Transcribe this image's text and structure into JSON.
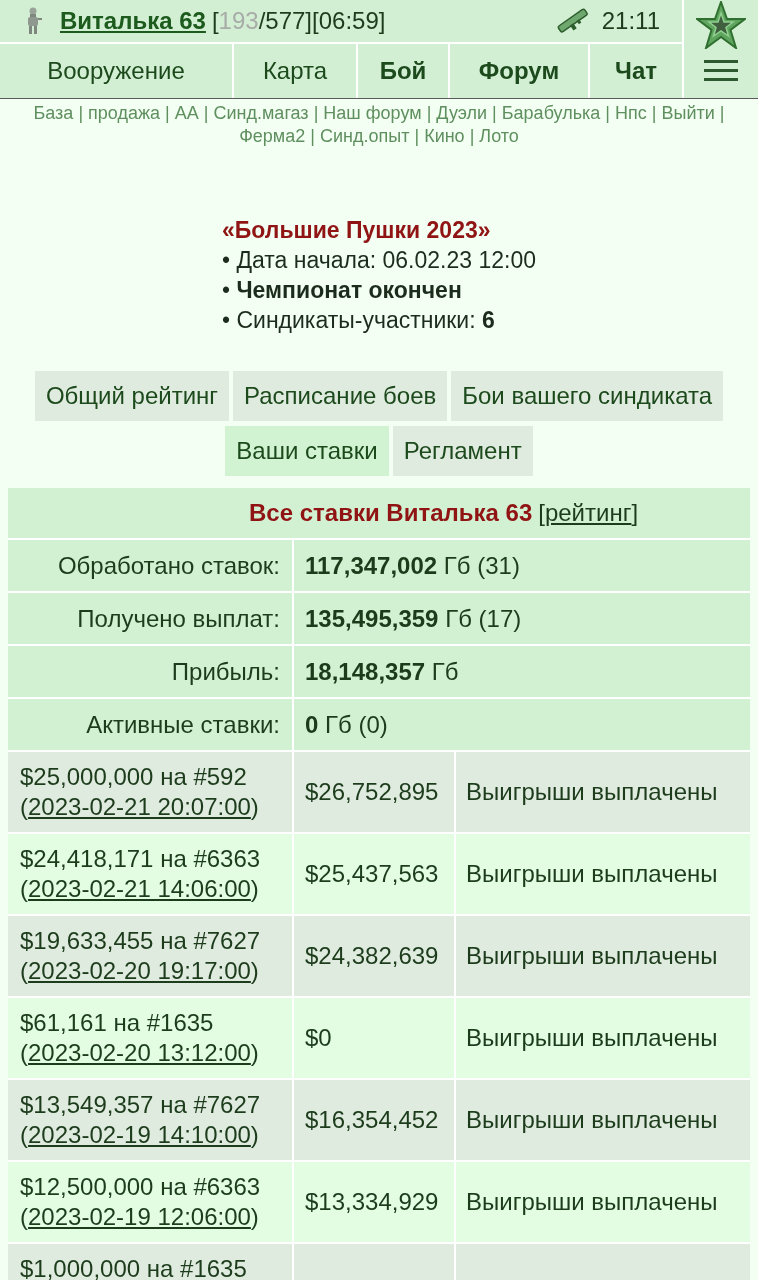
{
  "header": {
    "player": {
      "name": "Виталька 63",
      "stats": [
        {
          "text": "[",
          "dim": false
        },
        {
          "text": "193",
          "dim": true
        },
        {
          "text": "/577][06:59]",
          "dim": false
        }
      ]
    },
    "clock": "21:11",
    "nav": [
      {
        "label": "Вооружение",
        "bold": false
      },
      {
        "label": "Карта",
        "bold": false
      },
      {
        "label": "Бой",
        "bold": true
      },
      {
        "label": "Форум",
        "bold": true
      },
      {
        "label": "Чат",
        "bold": true
      }
    ]
  },
  "links": {
    "separator": "|",
    "items": [
      "База",
      "продажа",
      "АА",
      "Синд.магаз",
      "Наш форум",
      "Дуэли",
      "Барабулька",
      "Нпс",
      "Выйти",
      "Ферма2",
      "Синд.опыт",
      "Кино",
      "Лото"
    ]
  },
  "event": {
    "title": "«Большие Пушки 2023»",
    "facts": [
      "• Дата начала: 06.02.23 12:00",
      "• **Чемпионат окончен**",
      "• Синдикаты-участники: **6**"
    ]
  },
  "tabs": [
    {
      "label": "Общий рейтинг",
      "selected": false
    },
    {
      "label": "Расписание боев",
      "selected": false
    },
    {
      "label": "Бои вашего синдиката",
      "selected": false
    },
    {
      "label": "Ваши ставки",
      "selected": true
    },
    {
      "label": "Регламент",
      "selected": false
    }
  ],
  "bets_table": {
    "title": "Все ставки Виталька 63",
    "rating_link": {
      "open": "[",
      "label": "рейтинг",
      "close": "]"
    },
    "summary": [
      {
        "label": "Обработано ставок:",
        "value": "**117,347,002** Гб (31)"
      },
      {
        "label": "Получено выплат:",
        "value": "**135,495,359** Гб (17)"
      },
      {
        "label": "Прибыль:",
        "value": "**18,148,357** Гб"
      },
      {
        "label": "Активные ставки:",
        "value": "**0** Гб (0)"
      }
    ],
    "date_brackets": [
      "(",
      ")"
    ],
    "rows": [
      {
        "bet": "$25,000,000 на #592",
        "date": "2023-02-21 20:07:00",
        "payout": "$26,752,895",
        "status": "Выигрыши выплачены"
      },
      {
        "bet": "$24,418,171 на #6363",
        "date": "2023-02-21 14:06:00",
        "payout": "$25,437,563",
        "status": "Выигрыши выплачены"
      },
      {
        "bet": "$19,633,455 на #7627",
        "date": "2023-02-20 19:17:00",
        "payout": "$24,382,639",
        "status": "Выигрыши выплачены"
      },
      {
        "bet": "$61,161 на #1635",
        "date": "2023-02-20 13:12:00",
        "payout": "$0",
        "status": "Выигрыши выплачены"
      },
      {
        "bet": "$13,549,357 на #7627",
        "date": "2023-02-19 14:10:00",
        "payout": "$16,354,452",
        "status": "Выигрыши выплачены"
      },
      {
        "bet": "$12,500,000 на #6363",
        "date": "2023-02-19 12:06:00",
        "payout": "$13,334,929",
        "status": "Выигрыши выплачены"
      },
      {
        "bet": "$1,000,000 на #1635"
      }
    ]
  }
}
